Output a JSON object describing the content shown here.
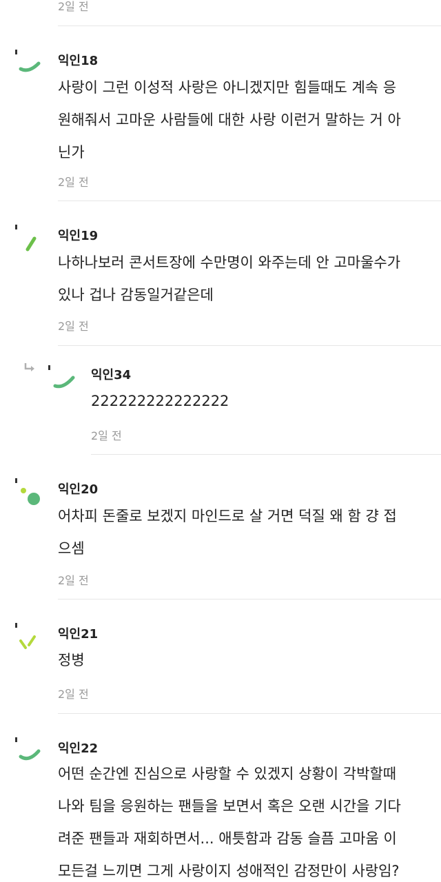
{
  "top": {
    "time": "2일 전"
  },
  "comments": [
    {
      "author": "익인18",
      "lines": [
        "사랑이 그런 이성적 사랑은 아니겠지만 힘들때도 계속 응",
        "원해줘서 고마운 사람들에 대한 사랑 이런거 말하는 거 아",
        "닌가"
      ],
      "time": "2일 전",
      "avatar_color": "#5bb87a"
    },
    {
      "author": "익인19",
      "lines": [
        "나하나보러 콘서트장에 수만명이 와주는데 안 고마울수가",
        "있나 겁나 감동일거같은데"
      ],
      "time": "2일 전",
      "avatar_color": "#6cc04a"
    },
    {
      "author": "익인34",
      "lines": [
        "222222222222222"
      ],
      "time": "2일 전",
      "avatar_color": "#5bb87a",
      "reply_icon": "reply-arrow-icon"
    },
    {
      "author": "익인20",
      "lines": [
        "어차피 돈줄로 보겠지 마인드로 살 거면 덕질 왜 함 걍 접",
        "으셈"
      ],
      "time": "2일 전",
      "avatar_color": "#5bb87a",
      "avatar_accent": "#b4d93c"
    },
    {
      "author": "익인21",
      "lines": [
        "정병"
      ],
      "time": "2일 전",
      "avatar_color": "#b4d93c",
      "avatar_accent": "#5bb87a"
    },
    {
      "author": "익인22",
      "lines": [
        "어떤 순간엔 진심으로 사랑할 수 있겠지 상황이 각박할때",
        "나와 팀을 응원하는 팬들을 보면서 혹은 오랜 시간을 기다",
        "려준 팬들과 재회하면서... 애틋함과 감동 슬픔 고마움 이",
        "모든걸 느끼면 그게 사랑이지 성애적인 감정만이 사랑임?"
      ],
      "avatar_color": "#5bb87a"
    }
  ]
}
